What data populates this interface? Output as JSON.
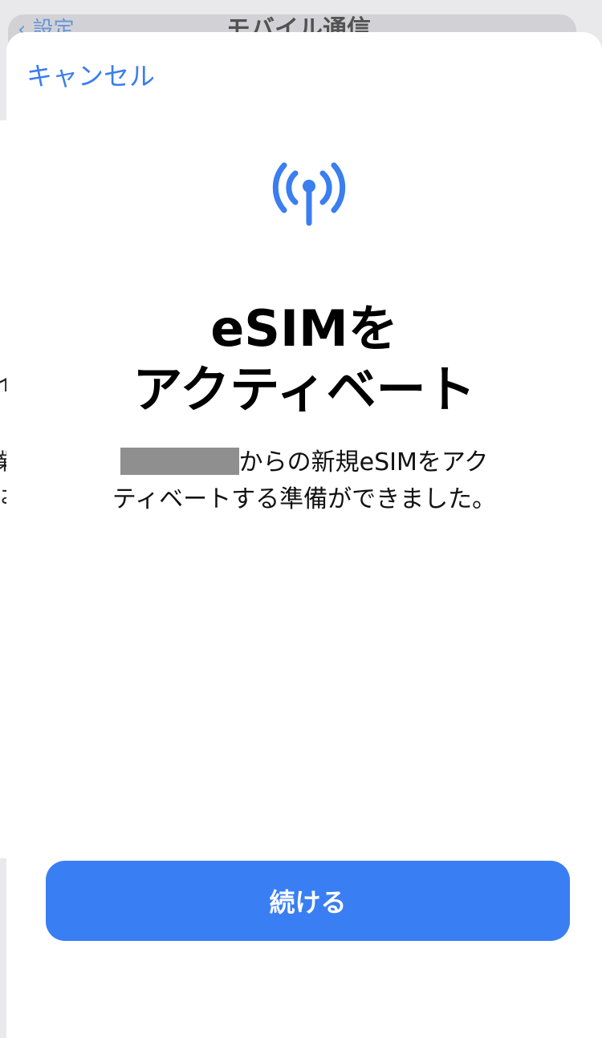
{
  "background_screen": {
    "back_label": "設定",
    "title": "モバイル通信",
    "peek_text_1": "イ",
    "peek_text_2": "業",
    "peek_text_3": "は"
  },
  "sheet": {
    "cancel_label": "キャンセル",
    "icon": "antenna-signal-icon",
    "title_line_1": "eSIMを",
    "title_line_2": "アクティベート",
    "description_part_1": "からの新規eSIMをアク",
    "description_part_2": "ティベートする準備ができました。",
    "continue_label": "続ける"
  },
  "colors": {
    "accent": "#3a7ef3",
    "link": "#3a7ef0",
    "redaction": "#8f8f8f"
  }
}
